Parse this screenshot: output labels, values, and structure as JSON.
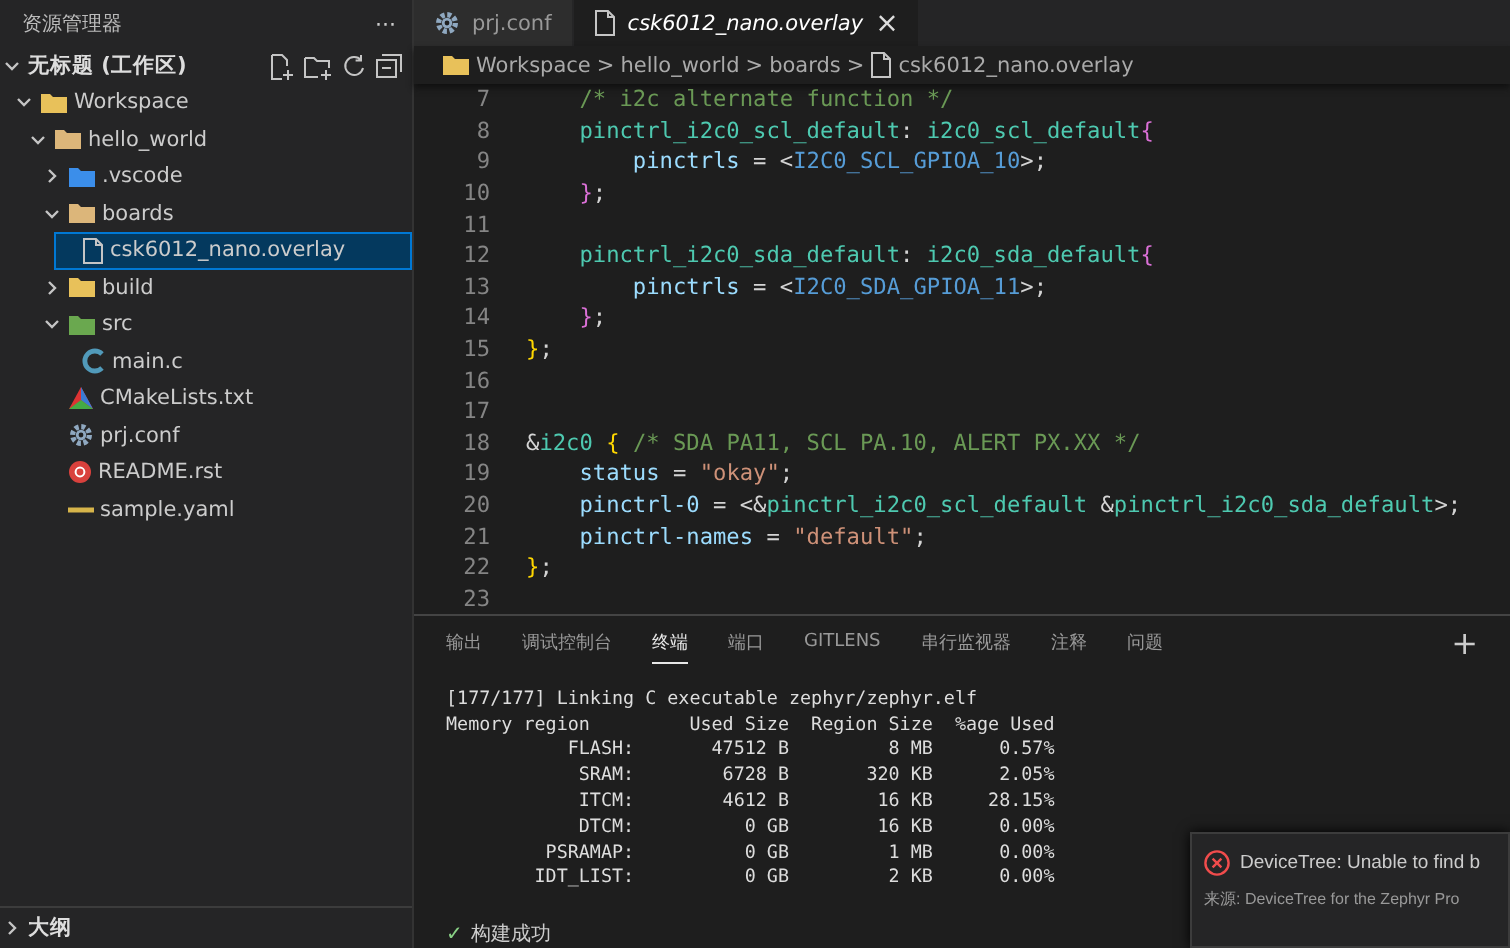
{
  "sidebar": {
    "title": "资源管理器",
    "more": "···",
    "root": {
      "label": "无标题 (工作区)",
      "expanded": true
    },
    "tree": [
      {
        "label": "Workspace",
        "kind": "workspace",
        "expanded": true,
        "selected": false,
        "children": [
          {
            "label": "hello_world",
            "kind": "folder",
            "expanded": true,
            "selected": false,
            "children": [
              {
                "label": ".vscode",
                "kind": "vscode-folder",
                "expanded": false,
                "selected": false
              },
              {
                "label": "boards",
                "kind": "folder",
                "expanded": true,
                "selected": false,
                "children": [
                  {
                    "label": "csk6012_nano.overlay",
                    "kind": "file",
                    "selected": true
                  }
                ]
              },
              {
                "label": "build",
                "kind": "build-folder",
                "expanded": false,
                "selected": false
              },
              {
                "label": "src",
                "kind": "src-folder",
                "expanded": true,
                "selected": false,
                "children": [
                  {
                    "label": "main.c",
                    "kind": "c-file",
                    "selected": false
                  }
                ]
              },
              {
                "label": "CMakeLists.txt",
                "kind": "cmake-file",
                "selected": false
              },
              {
                "label": "prj.conf",
                "kind": "conf-file",
                "selected": false
              },
              {
                "label": "README.rst",
                "kind": "readme-file",
                "selected": false
              },
              {
                "label": "sample.yaml",
                "kind": "yaml-file",
                "selected": false
              }
            ]
          }
        ]
      }
    ],
    "outline": {
      "label": "大纲",
      "expanded": false
    }
  },
  "tabs": [
    {
      "label": "prj.conf",
      "kind": "conf",
      "selected": false,
      "closable": false
    },
    {
      "label": "csk6012_nano.overlay",
      "kind": "file",
      "selected": true,
      "closable": true
    }
  ],
  "close_glyph": "×",
  "breadcrumbs": [
    {
      "label": "Workspace",
      "kind": "workspace"
    },
    {
      "label": "hello_world",
      "kind": "none"
    },
    {
      "label": "boards",
      "kind": "none"
    },
    {
      "label": "csk6012_nano.overlay",
      "kind": "file"
    }
  ],
  "breadcrumb_separator": ">",
  "code": [
    {
      "n": "7",
      "tokens": [
        {
          "t": "    /* i2c alternate function */",
          "kind": "comment"
        }
      ]
    },
    {
      "n": "8",
      "tokens": [
        {
          "t": "    pinctrl_i2c0_scl_default",
          "kind": "label"
        },
        {
          "t": ": ",
          "kind": "punct"
        },
        {
          "t": "i2c0_scl_default",
          "kind": "label"
        },
        {
          "t": "{",
          "kind": "brace2"
        }
      ]
    },
    {
      "n": "9",
      "tokens": [
        {
          "t": "        pinctrls",
          "kind": "prop"
        },
        {
          "t": " = <",
          "kind": "punct"
        },
        {
          "t": "I2C0_SCL_GPIOA_10",
          "kind": "macro"
        },
        {
          "t": ">;",
          "kind": "punct"
        }
      ]
    },
    {
      "n": "10",
      "tokens": [
        {
          "t": "    }",
          "kind": "brace2"
        },
        {
          "t": ";",
          "kind": "punct"
        }
      ]
    },
    {
      "n": "11"
    },
    {
      "n": "12",
      "tokens": [
        {
          "t": "    pinctrl_i2c0_sda_default",
          "kind": "label"
        },
        {
          "t": ": ",
          "kind": "punct"
        },
        {
          "t": "i2c0_sda_default",
          "kind": "label"
        },
        {
          "t": "{",
          "kind": "brace2"
        }
      ]
    },
    {
      "n": "13",
      "tokens": [
        {
          "t": "        pinctrls",
          "kind": "prop"
        },
        {
          "t": " = <",
          "kind": "punct"
        },
        {
          "t": "I2C0_SDA_GPIOA_11",
          "kind": "macro"
        },
        {
          "t": ">;",
          "kind": "punct"
        }
      ]
    },
    {
      "n": "14",
      "tokens": [
        {
          "t": "    }",
          "kind": "brace2"
        },
        {
          "t": ";",
          "kind": "punct"
        }
      ]
    },
    {
      "n": "15",
      "tokens": [
        {
          "t": "}",
          "kind": "brace1"
        },
        {
          "t": ";",
          "kind": "punct"
        }
      ]
    },
    {
      "n": "16"
    },
    {
      "n": "17"
    },
    {
      "n": "18",
      "tokens": [
        {
          "t": "&",
          "kind": "punct"
        },
        {
          "t": "i2c0",
          "kind": "label"
        },
        {
          "t": " {",
          "kind": "brace1"
        },
        {
          "t": " /* SDA PA11, SCL PA.10, ALERT PX.XX */",
          "kind": "comment"
        }
      ]
    },
    {
      "n": "19",
      "tokens": [
        {
          "t": "    status",
          "kind": "prop"
        },
        {
          "t": " = ",
          "kind": "punct"
        },
        {
          "t": "\"okay\"",
          "kind": "string"
        },
        {
          "t": ";",
          "kind": "punct"
        }
      ]
    },
    {
      "n": "20",
      "tokens": [
        {
          "t": "    pinctrl-0",
          "kind": "prop"
        },
        {
          "t": " = <&",
          "kind": "punct"
        },
        {
          "t": "pinctrl_i2c0_scl_default",
          "kind": "label"
        },
        {
          "t": " &",
          "kind": "punct"
        },
        {
          "t": "pinctrl_i2c0_sda_default",
          "kind": "label"
        },
        {
          "t": ">;",
          "kind": "punct"
        }
      ]
    },
    {
      "n": "21",
      "tokens": [
        {
          "t": "    pinctrl-names",
          "kind": "prop"
        },
        {
          "t": " = ",
          "kind": "punct"
        },
        {
          "t": "\"default\"",
          "kind": "string"
        },
        {
          "t": ";",
          "kind": "punct"
        }
      ]
    },
    {
      "n": "22",
      "tokens": [
        {
          "t": "}",
          "kind": "brace1"
        },
        {
          "t": ";",
          "kind": "punct"
        }
      ]
    },
    {
      "n": "23"
    }
  ],
  "panel": {
    "tabs": [
      {
        "label": "输出",
        "selected": false
      },
      {
        "label": "调试控制台",
        "selected": false
      },
      {
        "label": "终端",
        "selected": true
      },
      {
        "label": "端口",
        "selected": false
      },
      {
        "label": "GITLENS",
        "selected": false
      },
      {
        "label": "串行监视器",
        "selected": false
      },
      {
        "label": "注释",
        "selected": false
      },
      {
        "label": "问题",
        "selected": false
      }
    ],
    "add": "+",
    "terminal": [
      "[177/177] Linking C executable zephyr/zephyr.elf",
      "Memory region         Used Size  Region Size  %age Used",
      "           FLASH:       47512 B         8 MB      0.57%",
      "            SRAM:        6728 B       320 KB      2.05%",
      "            ITCM:        4612 B        16 KB     28.15%",
      "            DTCM:          0 GB        16 KB      0.00%",
      "         PSRAMAP:          0 GB         1 MB      0.00%",
      "        IDT_LIST:          0 GB         2 KB      0.00%"
    ],
    "status": {
      "check": "✓",
      "label": "构建成功"
    }
  },
  "notification": {
    "message": "DeviceTree: Unable to find b",
    "source": "来源: DeviceTree for the Zephyr Pro"
  }
}
